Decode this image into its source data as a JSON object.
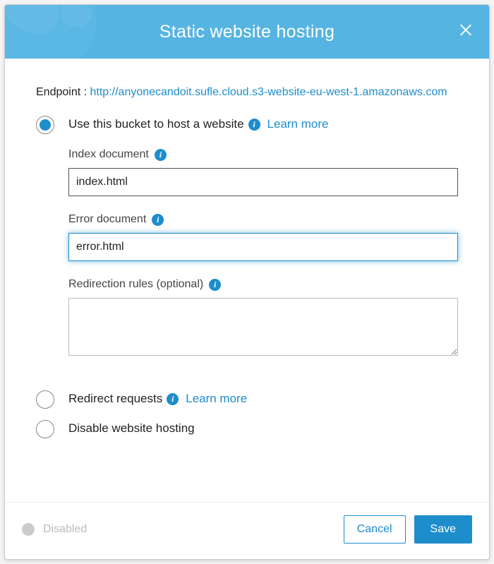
{
  "header": {
    "title": "Static website hosting"
  },
  "endpoint": {
    "label": "Endpoint :",
    "url_text": "http://anyonecandoit.sufle.cloud.s3-website-eu-west-1.amazonaws.com"
  },
  "options": {
    "use_bucket": {
      "label": "Use this bucket to host a website",
      "learn_more": "Learn more",
      "selected": true,
      "index_doc": {
        "label": "Index document",
        "value": "index.html"
      },
      "error_doc": {
        "label": "Error document",
        "value": "error.html"
      },
      "redirection_rules": {
        "label": "Redirection rules (optional)",
        "value": ""
      }
    },
    "redirect": {
      "label": "Redirect requests",
      "learn_more": "Learn more"
    },
    "disable": {
      "label": "Disable website hosting"
    }
  },
  "footer": {
    "status_label": "Disabled",
    "cancel": "Cancel",
    "save": "Save"
  },
  "icons": {
    "info": "i"
  }
}
